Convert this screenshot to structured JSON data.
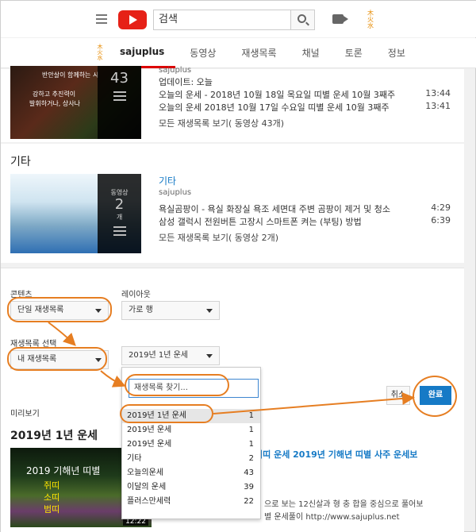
{
  "header": {
    "search_placeholder": "검색"
  },
  "channel": {
    "tabs": [
      {
        "label": "sajuplus"
      },
      {
        "label": "동영상"
      },
      {
        "label": "재생목록"
      },
      {
        "label": "채널"
      },
      {
        "label": "토론"
      },
      {
        "label": "정보"
      }
    ]
  },
  "playlist1": {
    "owner": "sajuplus",
    "updated": "업데이트: 오늘",
    "thumb_count": "43",
    "thumb_lines": [
      "반안살이 함께하는 시",
      "강하고 추진력이",
      "발휘하거나, 상사나"
    ],
    "videos": [
      {
        "title": "오늘의 운세 - 2018년 10월 18일 목요일 띠별 운세 10월 3째주",
        "duration": "13:44"
      },
      {
        "title": "오늘의 운세 2018년 10월 17일 수요일 띠별 운세 10월 3째주",
        "duration": "13:41"
      }
    ],
    "see_all": "모든 재생목록 보기( 동영상 43개)"
  },
  "playlist2": {
    "section_title": "기타",
    "title": "기타",
    "owner": "sajuplus",
    "thumb_label": "동영상",
    "thumb_count": "2",
    "thumb_unit": "개",
    "videos": [
      {
        "title": "욕실곰팡이 - 욕실 화장실 욕조 세면대 주변 곰팡이 제거 및 청소",
        "duration": "4:29"
      },
      {
        "title": "삼성 갤럭시 전원버튼 고장시 스마트폰 켜는 (부팅) 방법",
        "duration": "6:39"
      }
    ],
    "see_all": "모든 재생목록 보기( 동영상 2개)"
  },
  "editor": {
    "content_label": "콘텐츠",
    "content_value": "단일 재생목록",
    "layout_label": "레이아웃",
    "layout_value": "가로 행",
    "playlist_select_label": "재생목록 선택",
    "playlist_select_value": "내 재생목록",
    "playlist_value": "2019년 1년 운세",
    "cancel_label": "취소",
    "done_label": "완료",
    "preview_label": "미리보기"
  },
  "menu": {
    "search_placeholder": "재생목록 찾기...",
    "items": [
      {
        "name": "2019년 1년 운세",
        "count": "1"
      },
      {
        "name": "2019년 운세",
        "count": "1"
      },
      {
        "name": "2019년 운세",
        "count": "1"
      },
      {
        "name": "기타",
        "count": "2"
      },
      {
        "name": "오늘의운세",
        "count": "43"
      },
      {
        "name": "이달의 운세",
        "count": "39"
      },
      {
        "name": "플러스만세력",
        "count": "22"
      }
    ]
  },
  "preview": {
    "title": "2019년 1년 운세",
    "thumb_line1": "2019 기해년 띠별",
    "thumb_line2": "쥐띠",
    "thumb_line3": "소띠",
    "thumb_line4": "범띠",
    "thumb_duration": "12:22",
    "video_link": "이띠 운세 2019년 기해년 띠별 사주 운세보",
    "desc_line1": "으로 보는 12신살과 형 충 합을 중심으로 풀어보",
    "desc_line2": "별 운세풀이 http://www.sajuplus.net"
  },
  "colors": {
    "accent_blue": "#167ac6",
    "annotation_orange": "#e67e22",
    "youtube_red": "#e62117"
  }
}
